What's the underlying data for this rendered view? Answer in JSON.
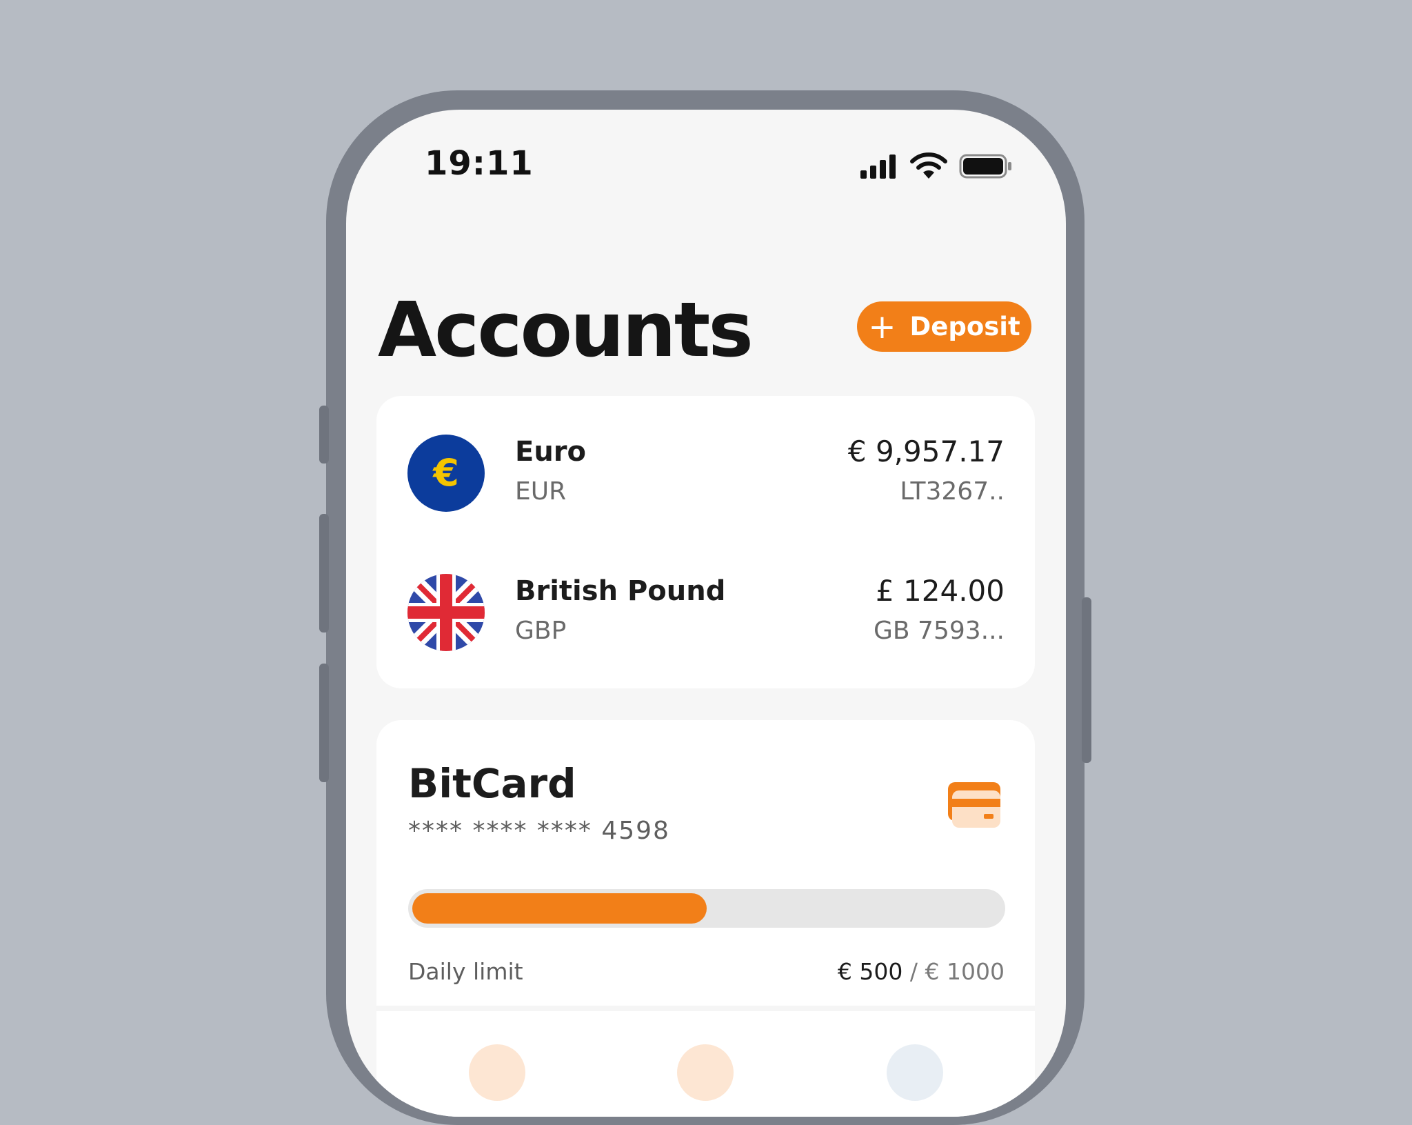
{
  "status_bar": {
    "time": "19:11",
    "icons": [
      "cellular-signal-icon",
      "wifi-icon",
      "battery-icon"
    ]
  },
  "header": {
    "title": "Accounts",
    "deposit_button": {
      "icon": "plus-icon",
      "label": "Deposit",
      "color": "#F27F18"
    }
  },
  "accounts": [
    {
      "name": "Euro",
      "code": "EUR",
      "amount": "€ 9,957.17",
      "iban": "LT3267..",
      "icon": "euro-flag-icon"
    },
    {
      "name": "British Pound",
      "code": "GBP",
      "amount": "£ 124.00",
      "iban": "GB 7593...",
      "icon": "uk-flag-icon"
    }
  ],
  "bitcard": {
    "title": "BitCard",
    "masked_number": "**** **** **** 4598",
    "icon": "credit-card-icon",
    "daily_limit": {
      "label": "Daily limit",
      "used": "€ 500",
      "separator": "/",
      "max": "€ 1000",
      "fraction": 0.5
    }
  },
  "colors": {
    "accent": "#F27F18",
    "background": "#B6BBC3",
    "screen": "#F6F6F6",
    "card": "#FFFFFF"
  }
}
